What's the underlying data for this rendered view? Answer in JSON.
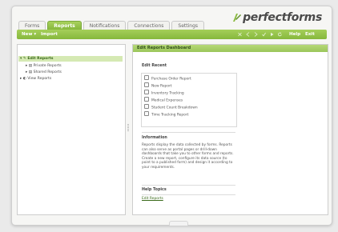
{
  "tabs": [
    "Forms",
    "Reports",
    "Notifications",
    "Connections",
    "Settings"
  ],
  "active_tab_index": 1,
  "brand": {
    "logo_text": "perfectforms",
    "accent": "#8bbb42",
    "accent_dark": "#3a6a1a"
  },
  "toolbar": {
    "new_label": "New",
    "import_label": "Import",
    "help_label": "Help",
    "exit_label": "Exit",
    "icons": [
      "close-icon",
      "prev-icon",
      "next-icon",
      "check-icon",
      "run-icon",
      "refresh-icon"
    ]
  },
  "tree": {
    "edit_reports": "Edit Reports",
    "private_reports": "Private Reports",
    "shared_reports": "Shared Reports",
    "view_reports": "View Reports"
  },
  "main": {
    "header": "Edit Reports Dashboard",
    "recent_title": "Edit Recent",
    "recent_items": [
      "Purchase Order Report",
      "New Report",
      "Inventory Tracking",
      "Medical Expenses",
      "Student Count Breakdown",
      "Time Tracking Report"
    ],
    "info_title": "Information",
    "info_text": "Reports display the data collected by forms. Reports can also serve as portal pages or drill-down dashboards that take you to other forms and reports. Create a new report, configure its data source (to point to a published form) and design it according to your requirements.",
    "help_title": "Help Topics",
    "help_link": "Edit Reports"
  }
}
